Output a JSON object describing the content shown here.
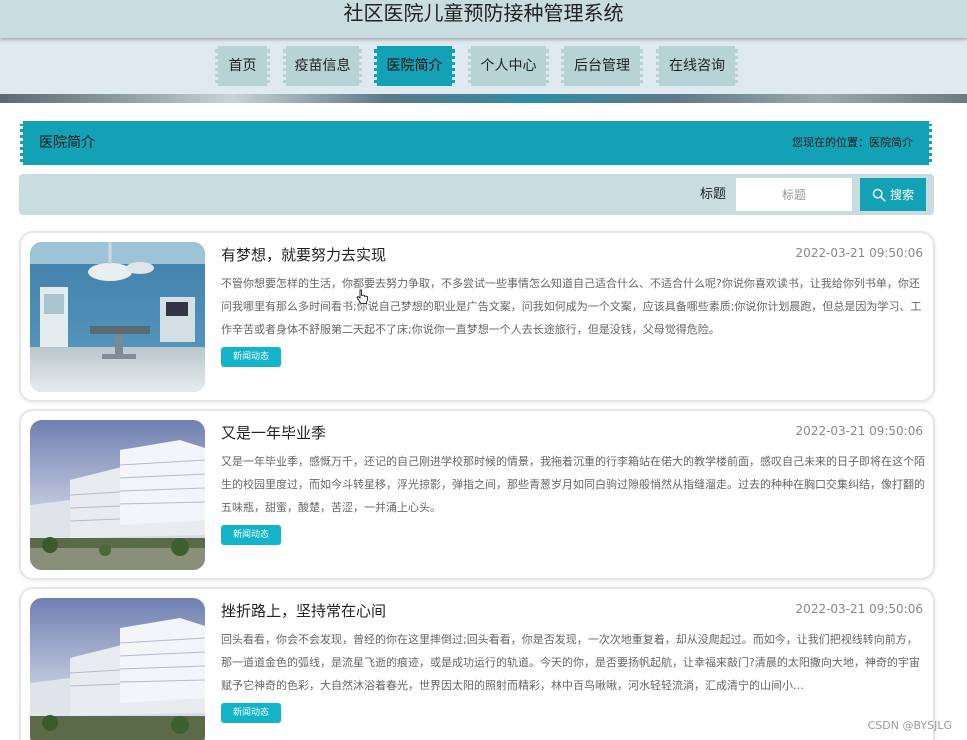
{
  "header": {
    "site_title": "社区医院儿童预防接种管理系统"
  },
  "nav": {
    "items": [
      {
        "label": "首页"
      },
      {
        "label": "疫苗信息"
      },
      {
        "label": "医院简介"
      },
      {
        "label": "个人中心"
      },
      {
        "label": "后台管理"
      },
      {
        "label": "在线咨询"
      }
    ],
    "active": "医院简介"
  },
  "section": {
    "title": "医院简介",
    "breadcrumb": "您现在的位置：医院简介"
  },
  "search": {
    "label": "标题",
    "placeholder": "标题",
    "button_label": "搜索"
  },
  "articles": [
    {
      "title": "有梦想，就要努力去实现",
      "date": "2022-03-21 09:50:06",
      "desc": "不管你想要怎样的生活，你都要去努力争取，不多尝试一些事情怎么知道自己适合什么、不适合什么呢?你说你喜欢读书，让我给你列书单，你还问我哪里有那么多时间看书;你说自己梦想的职业是广告文案，问我如何成为一个文案，应该具备哪些素质;你说你计划晨跑，但总是因为学习、工作辛苦或者身体不舒服第二天起不了床;你说你一直梦想一个人去长途旅行，但是没钱，父母觉得危险。",
      "tag": "新闻动态",
      "image": "operating-room-photo"
    },
    {
      "title": "又是一年毕业季",
      "date": "2022-03-21 09:50:06",
      "desc": "又是一年毕业季，感慨万千，还记的自己刚进学校那时候的情景，我拖着沉重的行李箱站在偌大的教学楼前面，感叹自己未来的日子即将在这个陌生的校园里度过，而如今斗转星移，浮光掠影，弹指之间，那些青葱岁月如同白驹过隙般悄然从指缝溜走。过去的种种在胸口交集纠结，像打翻的五味瓶，甜蜜，酸楚，苦涩，一并涌上心头。",
      "tag": "新闻动态",
      "image": "hospital-building-photo"
    },
    {
      "title": "挫折路上，坚持常在心间",
      "date": "2022-03-21 09:50:06",
      "desc": "回头看看，你会不会发现，曾经的你在这里摔倒过;回头看看，你是否发现，一次次地重复着，却从没爬起过。而如今，让我们把视线转向前方，那一道道金色的弧线，是流星飞逝的痕迹，或是成功运行的轨道。今天的你，是否要扬帆起航，让幸福来敲门?清晨的太阳撒向大地，神奇的宇宙赋予它神奇的色彩，大自然沐浴着春光，世界因太阳的照射而精彩，林中百鸟啾啾，河水轻轻流淌，汇成清宁的山间小…",
      "tag": "新闻动态",
      "image": "hospital-building-photo"
    }
  ],
  "watermark": "CSDN @BYSJLG",
  "colors": {
    "accent": "#13a1b6",
    "header_bg": "#c9dde0",
    "nav_bg": "#dfeaf0",
    "tag_bg": "#13b4c9"
  }
}
